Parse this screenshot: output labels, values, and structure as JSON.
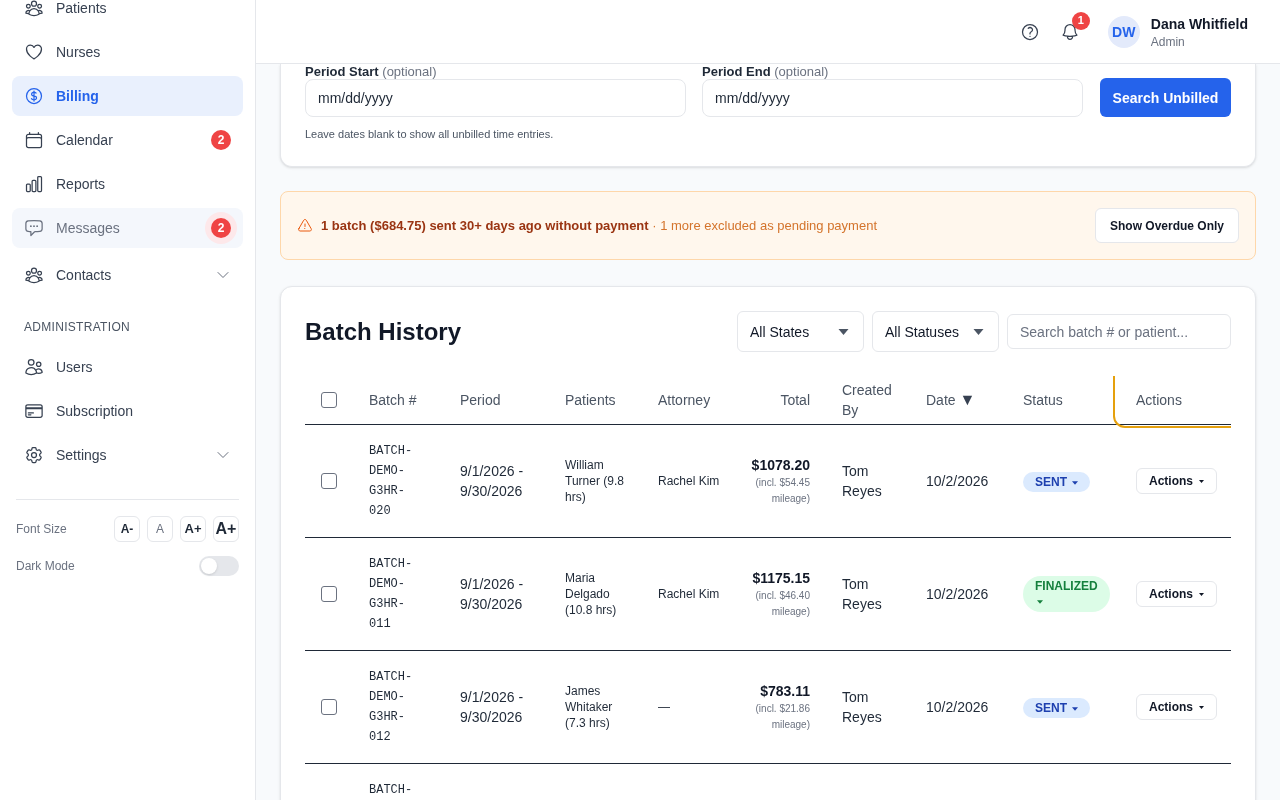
{
  "sidebar": {
    "groups": [
      {
        "items": [
          {
            "label": "Patients",
            "kind": "link",
            "selected": false,
            "hovered": false
          },
          {
            "label": "Nurses",
            "kind": "link",
            "selected": false,
            "hovered": false
          },
          {
            "label": "Billing",
            "kind": "link",
            "selected": true,
            "hovered": false
          },
          {
            "label": "Calendar",
            "kind": "link",
            "selected": false,
            "hovered": false,
            "badge": {
              "count": "2",
              "pulse": false
            }
          },
          {
            "label": "Reports",
            "kind": "link",
            "selected": false,
            "hovered": false
          },
          {
            "label": "Messages",
            "kind": "link",
            "selected": false,
            "hovered": true,
            "badge": {
              "count": "2",
              "pulse": true
            }
          }
        ]
      },
      {
        "items": [
          {
            "label": "Contacts",
            "kind": "group",
            "expanded": false,
            "selected": false,
            "hovered": false
          }
        ]
      },
      {
        "heading": "ADMINISTRATION",
        "items": [
          {
            "label": "Users",
            "kind": "link",
            "selected": false,
            "hovered": false
          },
          {
            "label": "Subscription",
            "kind": "link",
            "selected": false,
            "hovered": false
          },
          {
            "label": "Settings",
            "kind": "group",
            "expanded": false,
            "selected": false,
            "hovered": false
          }
        ]
      }
    ],
    "font_size": {
      "label": "Font Size",
      "buttons": [
        "A-",
        "A",
        "A+",
        "A+"
      ]
    },
    "dark_mode": {
      "label": "Dark Mode",
      "on": false
    }
  },
  "header": {
    "notifications": "1",
    "user": {
      "initials": "DW",
      "name": "Dana Whitfield",
      "role": "Admin"
    }
  },
  "unbilled_search": {
    "fields": [
      {
        "label": "**Period Start** (optional)",
        "placeholder": "mm/dd/yyyy"
      },
      {
        "label": "**Period End** (optional)",
        "placeholder": "mm/dd/yyyy"
      }
    ],
    "button": "Search Unbilled",
    "help": "Leave dates blank to show all unbilled time entries."
  },
  "alert": {
    "message": "**1 batch ($684.75) sent 30+ days ago without payment** · 1 more excluded as pending payment",
    "button": "Show Overdue Only"
  },
  "batch_history": {
    "title": "Batch History",
    "filters": [
      {
        "label": "All States"
      },
      {
        "label": "All Statuses"
      }
    ],
    "search": {
      "placeholder": "Search batch # or patient..."
    },
    "table": {
      "select_all_checked": false,
      "columns": [
        {
          "label": "Batch #",
          "focused": false
        },
        {
          "label": "Period",
          "focused": false
        },
        {
          "label": "Patients",
          "focused": false
        },
        {
          "label": "Attorney",
          "focused": false
        },
        {
          "label": "Total",
          "focused": false
        },
        {
          "label": "Created By",
          "focused": false
        },
        {
          "label": "Date",
          "sort_indicator": "▼",
          "focused": false
        },
        {
          "label": "Status",
          "focused": false
        },
        {
          "label": "Actions",
          "focused": true
        }
      ],
      "rows": [
        {
          "checked": false,
          "batch": "BATCH-DEMO-G3HR-020",
          "period": "9/1/2026 - 9/30/2026",
          "patients": "William Turner (9.8 hrs)",
          "attorney": "Rachel Kim",
          "total": "$1078.20",
          "total_note": "(incl. $54.45 mileage)",
          "created_by": "Tom Reyes",
          "date": "10/2/2026",
          "status": {
            "label": "SENT",
            "kind": "sent"
          },
          "action": "Actions"
        },
        {
          "checked": false,
          "batch": "BATCH-DEMO-G3HR-011",
          "period": "9/1/2026 - 9/30/2026",
          "patients": "Maria Delgado (10.8 hrs)",
          "attorney": "Rachel Kim",
          "total": "$1175.15",
          "total_note": "(incl. $46.40 mileage)",
          "created_by": "Tom Reyes",
          "date": "10/2/2026",
          "status": {
            "label": "FINALIZED",
            "kind": "finalized"
          },
          "action": "Actions"
        },
        {
          "checked": false,
          "batch": "BATCH-DEMO-G3HR-012",
          "period": "9/1/2026 - 9/30/2026",
          "patients": "James Whitaker (7.3 hrs)",
          "attorney": "—",
          "total": "$783.11",
          "total_note": "(incl. $21.86 mileage)",
          "created_by": "Tom Reyes",
          "date": "10/2/2026",
          "status": {
            "label": "SENT",
            "kind": "sent"
          },
          "action": "Actions"
        },
        {
          "batch": "BATCH-"
        }
      ]
    }
  }
}
